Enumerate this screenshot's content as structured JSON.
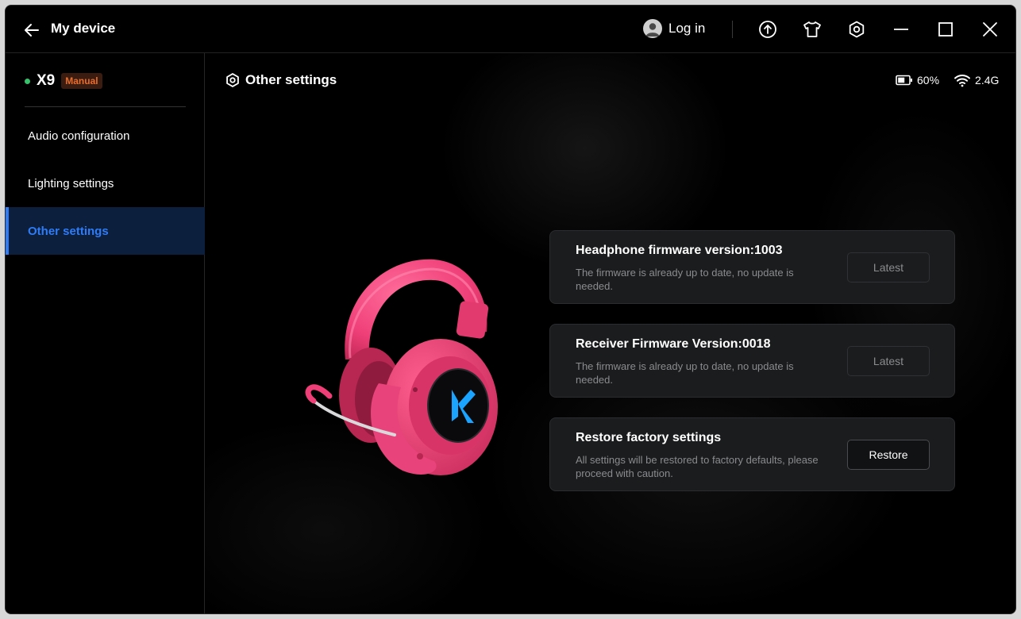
{
  "titlebar": {
    "title": "My device",
    "login_label": "Log in",
    "icons": [
      "back-arrow-icon",
      "user-avatar-icon",
      "upload-icon",
      "tshirt-icon",
      "settings-hex-icon",
      "minimize-icon",
      "maximize-icon",
      "close-icon"
    ]
  },
  "sidebar": {
    "device_name": "X9",
    "mode_badge": "Manual",
    "items": [
      {
        "label": "Audio configuration"
      },
      {
        "label": "Lighting settings"
      },
      {
        "label": "Other settings"
      }
    ],
    "active_index": 2
  },
  "main": {
    "section_title": "Other settings",
    "battery": "60%",
    "connection": "2.4G",
    "cards": [
      {
        "title": "Headphone firmware version:1003",
        "description": "The firmware is already up to date, no update is needed.",
        "button_label": "Latest"
      },
      {
        "title": "Receiver Firmware Version:0018",
        "description": "The firmware is already up to date, no update is needed.",
        "button_label": "Latest"
      },
      {
        "title": "Restore factory settings",
        "description": "All settings will be restored to factory defaults, please proceed with caution.",
        "button_label": "Restore"
      }
    ]
  },
  "colors": {
    "accent": "#2f7cf6",
    "active_bg": "#0c1f3d",
    "online_dot": "#36c26b",
    "badge_text": "#e86c2c",
    "badge_bg": "#3a1c10",
    "card_bg": "#1b1c1e",
    "headphone_pink": "#ef3f78"
  }
}
